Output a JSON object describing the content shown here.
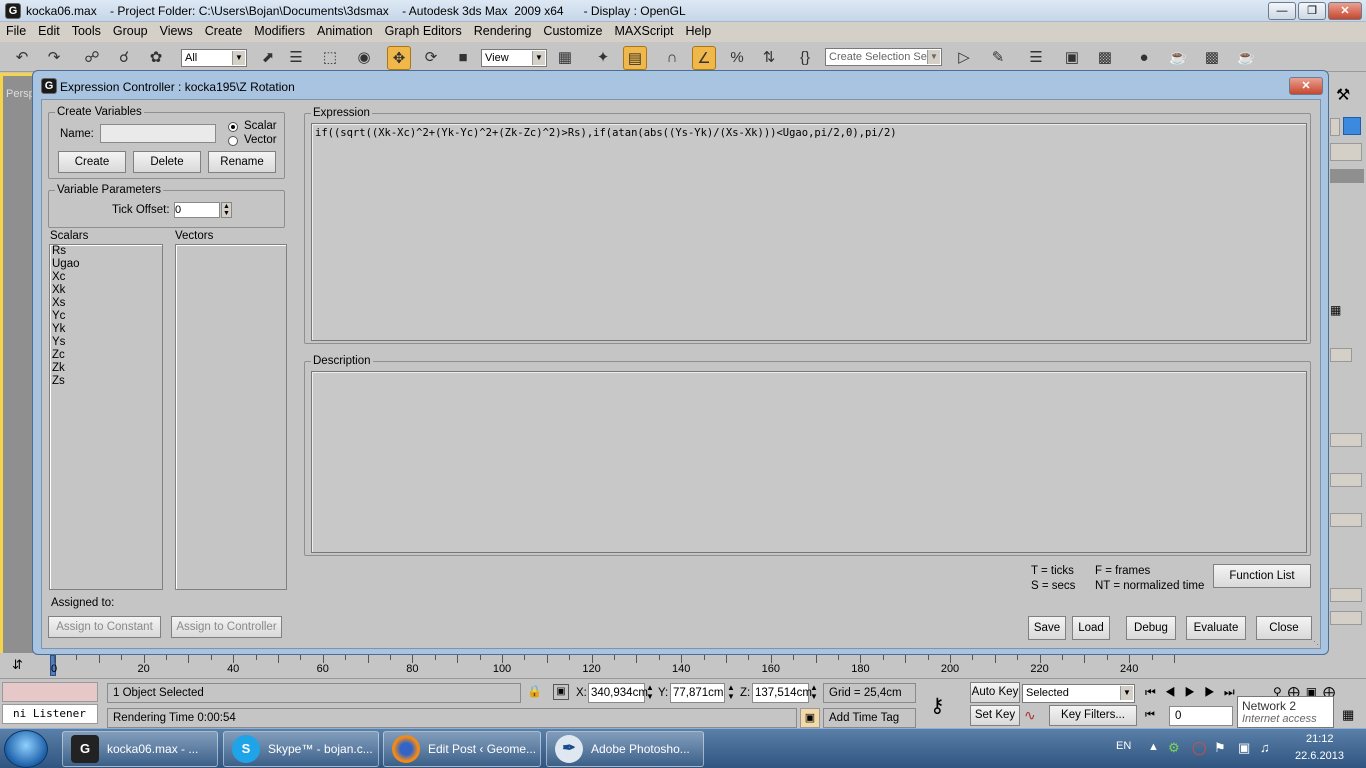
{
  "app": {
    "title": "kocka06.max    - Project Folder: C:\\Users\\Bojan\\Documents\\3dsmax    - Autodesk 3ds Max  2009 x64      - Display : OpenGL"
  },
  "menu": [
    "File",
    "Edit",
    "Tools",
    "Group",
    "Views",
    "Create",
    "Modifiers",
    "Animation",
    "Graph Editors",
    "Rendering",
    "Customize",
    "MAXScript",
    "Help"
  ],
  "toolbar": {
    "filter_select": "All",
    "coord_select": "View",
    "selection_set": "Create Selection Set"
  },
  "viewport": {
    "label": "Persp"
  },
  "dialog": {
    "title": "Expression Controller : kocka195\\Z Rotation",
    "create_variables": {
      "legend": "Create Variables",
      "name_label": "Name:",
      "name_value": "",
      "scalar_label": "Scalar",
      "vector_label": "Vector",
      "selected_type": "Scalar",
      "create_btn": "Create",
      "delete_btn": "Delete",
      "rename_btn": "Rename"
    },
    "variable_parameters": {
      "legend": "Variable Parameters",
      "tick_offset_label": "Tick Offset:",
      "tick_offset_value": "0"
    },
    "scalars_header": "Scalars",
    "vectors_header": "Vectors",
    "scalars": [
      "Rs",
      "Ugao",
      "Xc",
      "Xk",
      "Xs",
      "Yc",
      "Yk",
      "Ys",
      "Zc",
      "Zk",
      "Zs"
    ],
    "vectors": [],
    "assigned_to_label": "Assigned to:",
    "assign_constant_btn": "Assign to Constant",
    "assign_controller_btn": "Assign to Controller",
    "expression_legend": "Expression",
    "expression": "if((sqrt((Xk-Xc)^2+(Yk-Yc)^2+(Zk-Zc)^2)>Rs),if(atan(abs((Ys-Yk)/(Xs-Xk)))<Ugao,pi/2,0),pi/2)",
    "description_legend": "Description",
    "description": "",
    "legend_t": "T = ticks",
    "legend_s": "S = secs",
    "legend_f": "F = frames",
    "legend_nt": "NT = normalized time",
    "function_list_btn": "Function List",
    "save_btn": "Save",
    "load_btn": "Load",
    "debug_btn": "Debug",
    "evaluate_btn": "Evaluate",
    "close_btn": "Close"
  },
  "timeline": {
    "labels": [
      "0",
      "20",
      "40",
      "60",
      "80",
      "100",
      "120",
      "140",
      "160",
      "180",
      "200",
      "220",
      "240"
    ]
  },
  "status": {
    "listener": "ni Listener",
    "selection": "1 Object Selected",
    "render_time": "Rendering Time  0:00:54",
    "x_label": "X:",
    "x_value": "340,934cm",
    "y_label": "Y:",
    "y_value": "77,871cm",
    "z_label": "Z:",
    "z_value": "137,514cm",
    "grid": "Grid = 25,4cm",
    "add_time_tag": "Add Time Tag",
    "auto_key": "Auto Key",
    "set_key": "Set Key",
    "key_mode": "Selected",
    "key_filters": "Key Filters...",
    "frame": "0"
  },
  "taskbar": {
    "items": [
      "kocka06.max    - ...",
      "Skype™ - bojan.c...",
      "Edit Post ‹ Geome...",
      "Adobe Photosho..."
    ],
    "lang": "EN",
    "time": "21:12",
    "date": "22.6.2013",
    "network_title": "Network  2",
    "network_status": "Internet access"
  }
}
